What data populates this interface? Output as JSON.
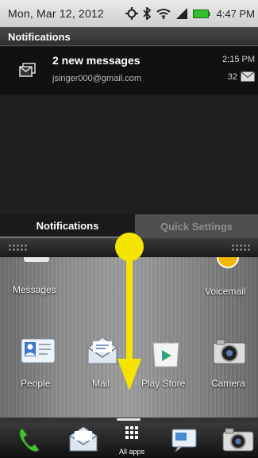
{
  "status_bar": {
    "date": "Mon, Mar 12, 2012",
    "time": "4:47 PM",
    "icons": [
      "gps-icon",
      "bluetooth-icon",
      "wifi-icon",
      "signal-icon",
      "battery-icon"
    ]
  },
  "notifications": {
    "header": "Notifications",
    "items": [
      {
        "icon": "message-icon",
        "title": "2 new messages",
        "account": "jsinger000@gmail.com",
        "time": "2:15 PM",
        "count": "32",
        "badge_icon": "mail-icon"
      }
    ]
  },
  "tabs": [
    {
      "label": "Notifications",
      "active": true
    },
    {
      "label": "Quick Settings",
      "active": false
    }
  ],
  "home": {
    "top_row": [
      {
        "label": "Messages",
        "icon": "messages-icon"
      },
      {
        "label": "Voicemail",
        "icon": "voicemail-icon"
      }
    ],
    "apps": [
      {
        "label": "People",
        "icon": "people-icon"
      },
      {
        "label": "Mail",
        "icon": "mail-icon"
      },
      {
        "label": "Play Store",
        "icon": "play-store-icon"
      },
      {
        "label": "Camera",
        "icon": "camera-icon"
      }
    ]
  },
  "dock": {
    "items": [
      {
        "name": "phone",
        "icon": "phone-icon"
      },
      {
        "name": "mail",
        "icon": "mail-icon"
      },
      {
        "name": "all-apps",
        "icon": "grid-icon",
        "label": "All apps"
      },
      {
        "name": "messages",
        "icon": "messages-icon"
      },
      {
        "name": "camera",
        "icon": "camera-icon"
      }
    ]
  },
  "colors": {
    "annotation": "#f5e400",
    "status_bar_bg": "#d9d9d9",
    "shade_bg": "#1b1b1b"
  }
}
